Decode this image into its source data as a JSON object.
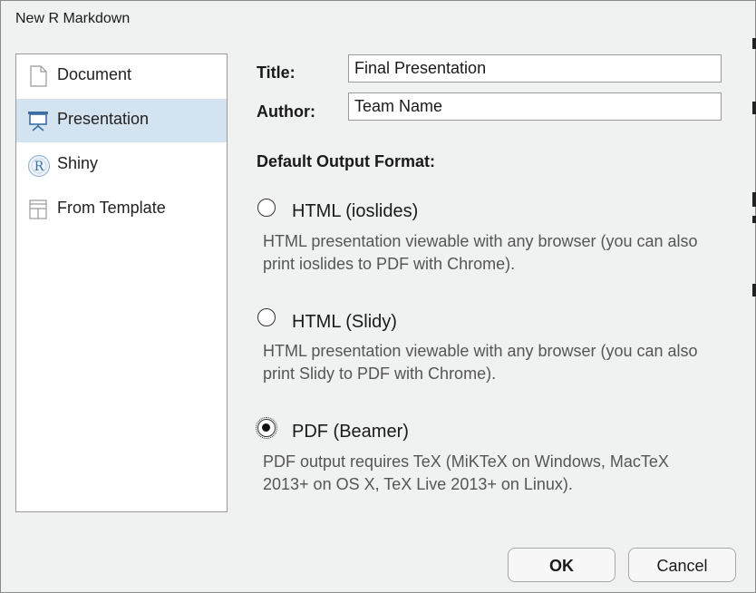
{
  "window": {
    "title": "New R Markdown"
  },
  "sidebar": {
    "items": [
      {
        "label": "Document",
        "icon": "document-icon",
        "selected": false
      },
      {
        "label": "Presentation",
        "icon": "presentation-icon",
        "selected": true
      },
      {
        "label": "Shiny",
        "icon": "shiny-r-icon",
        "selected": false
      },
      {
        "label": "From Template",
        "icon": "template-icon",
        "selected": false
      }
    ]
  },
  "form": {
    "title_label": "Title:",
    "title_value": "Final Presentation",
    "author_label": "Author:",
    "author_value": "Team Name"
  },
  "output": {
    "heading": "Default Output Format:",
    "options": [
      {
        "label": "HTML (ioslides)",
        "description": "HTML presentation viewable with any browser (you can also print ioslides to PDF with Chrome).",
        "selected": false
      },
      {
        "label": "HTML (Slidy)",
        "description": "HTML presentation viewable with any browser (you can also print Slidy to PDF with Chrome).",
        "selected": false
      },
      {
        "label": "PDF (Beamer)",
        "description": "PDF output requires TeX (MiKTeX on Windows, MacTeX 2013+ on OS X, TeX Live 2013+ on Linux).",
        "selected": true
      }
    ]
  },
  "buttons": {
    "ok": "OK",
    "cancel": "Cancel"
  },
  "colors": {
    "selection": "#d3e3ef",
    "dialog_background": "#f0f2f1",
    "icon_blue": "#3a6ea5"
  }
}
